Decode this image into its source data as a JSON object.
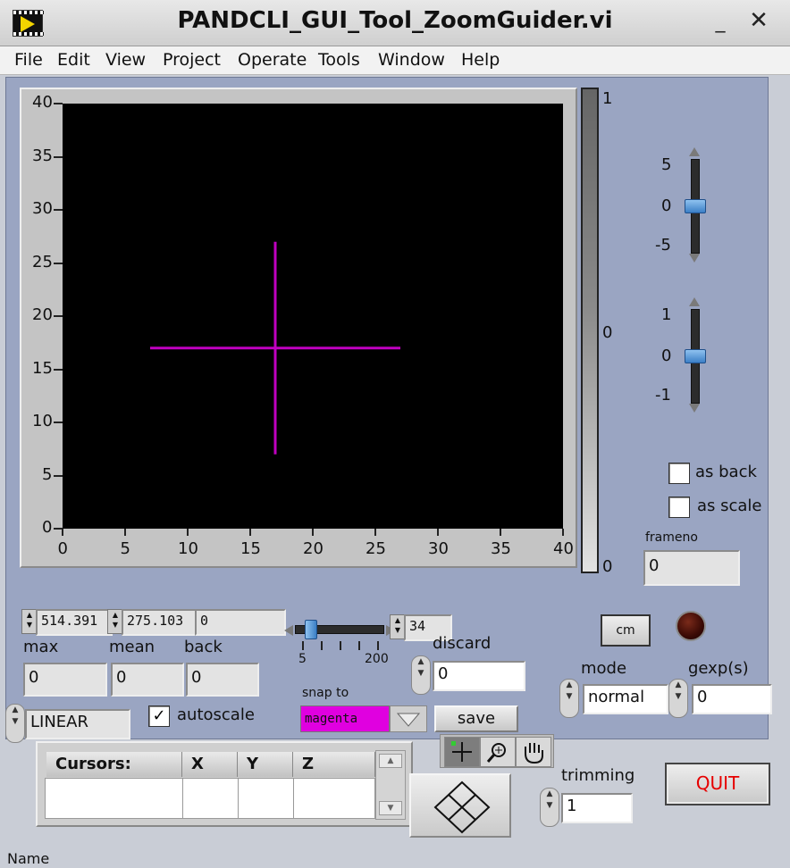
{
  "window": {
    "title": "PANDCLI_GUI_Tool_ZoomGuider.vi",
    "minimize": "_",
    "close": "✕"
  },
  "menu": [
    "File",
    "Edit",
    "View",
    "Project",
    "Operate",
    "Tools",
    "Window",
    "Help"
  ],
  "graph": {
    "x_ticks": [
      "0",
      "5",
      "10",
      "15",
      "20",
      "25",
      "30",
      "35",
      "40"
    ],
    "y_ticks": [
      "40",
      "35",
      "30",
      "25",
      "20",
      "15",
      "10",
      "5",
      "0"
    ],
    "xlim": [
      0,
      40
    ],
    "ylim": [
      0,
      40
    ],
    "crosshair": {
      "x": 17,
      "y": 17,
      "half_width": 10,
      "half_height": 10,
      "color": "#c000c0"
    }
  },
  "color_ramp": {
    "top": "1",
    "middle": "0",
    "bottom": "0"
  },
  "slider_top": {
    "ticks": [
      "5",
      "0",
      "-5"
    ],
    "value": 0
  },
  "slider_bottom": {
    "ticks": [
      "1",
      "0",
      "-1"
    ],
    "value": 0
  },
  "checkboxes": {
    "as_back": "as back",
    "as_scale": "as scale",
    "autoscale": "autoscale",
    "autoscale_checked": "✓"
  },
  "frameno": {
    "label": "frameno",
    "value": "0"
  },
  "numerics": {
    "v1": "514.391",
    "v2": "275.103",
    "v3": "0"
  },
  "stats": {
    "max_label": "max",
    "max": "0",
    "mean_label": "mean",
    "mean": "0",
    "back_label": "back",
    "back": "0"
  },
  "scale_mode": "LINEAR",
  "hslider": {
    "min": "5",
    "max": "200",
    "value": "34"
  },
  "discard": {
    "label": "discard",
    "value": "0"
  },
  "snap": {
    "label": "snap to",
    "value": "magenta",
    "color": "#e000e0"
  },
  "buttons": {
    "save": "save",
    "cm": "cm",
    "quit": "QUIT"
  },
  "mode": {
    "label": "mode",
    "value": "normal"
  },
  "gexp": {
    "label": "gexp(s)",
    "value": "0"
  },
  "cursor_table": {
    "headers": [
      "Cursors:",
      "X",
      "Y",
      "Z"
    ]
  },
  "trimming": {
    "label": "trimming",
    "value": "1"
  },
  "footer": {
    "name_label": "Name"
  }
}
